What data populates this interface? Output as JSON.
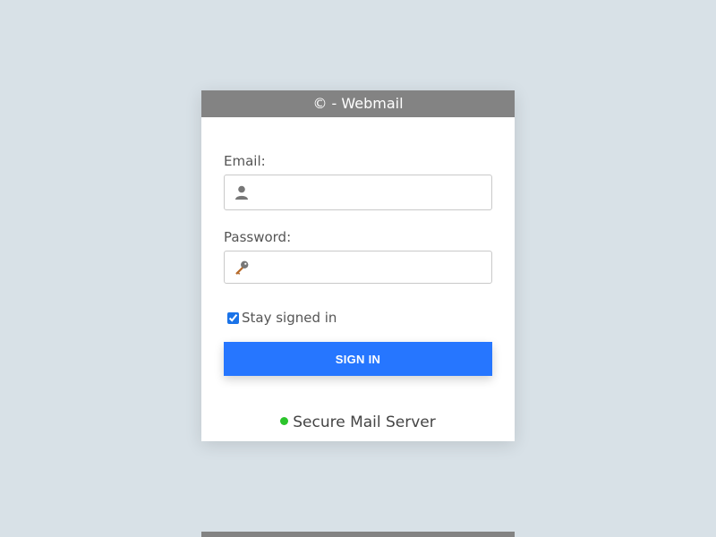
{
  "card": {
    "title": "© - Webmail"
  },
  "email": {
    "label": "Email:",
    "value": "",
    "placeholder": "",
    "icon": "user-icon"
  },
  "password": {
    "label": "Password:",
    "value": "",
    "placeholder": "",
    "icon": "key-icon"
  },
  "remember": {
    "label": "Stay signed in",
    "checked": true
  },
  "signin": {
    "label": "SIGN IN"
  },
  "server": {
    "label": "Secure Mail Server",
    "status_color": "#2bc42b"
  },
  "colors": {
    "background": "#d8e1e7",
    "header": "#838383",
    "accent": "#2676ff"
  }
}
